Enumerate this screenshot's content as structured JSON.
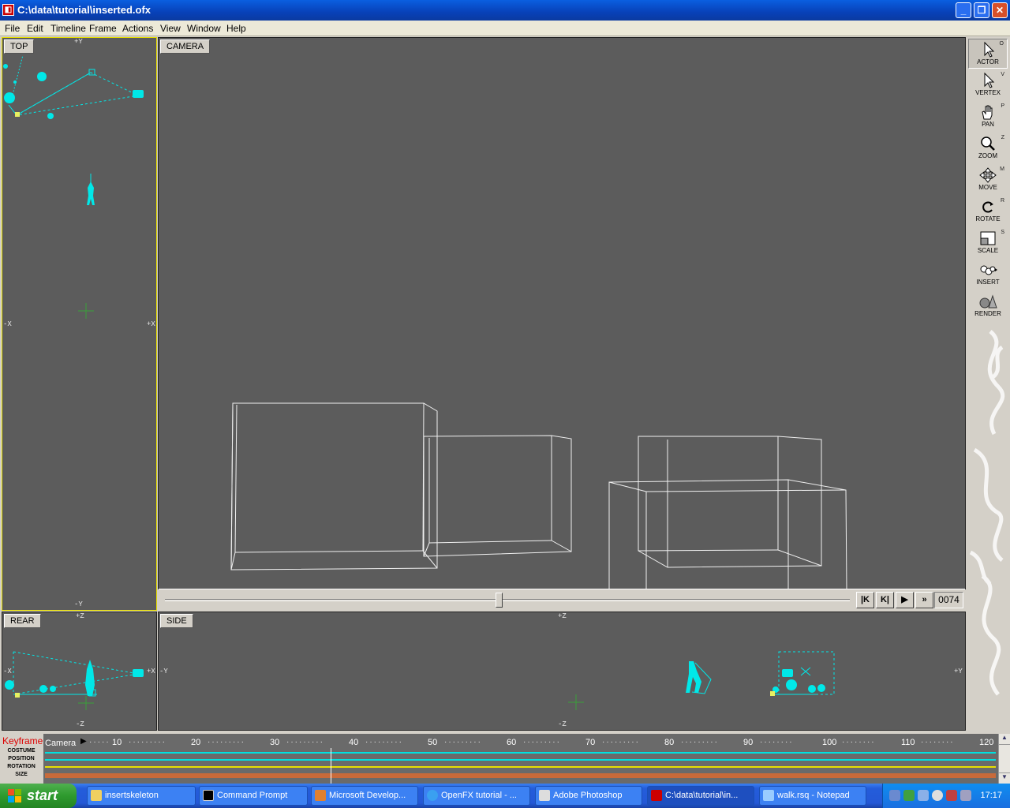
{
  "window": {
    "title": "C:\\data\\tutorial\\inserted.ofx"
  },
  "menu": [
    "File",
    "Edit",
    "Timeline",
    "Frame",
    "Actions",
    "View",
    "Window",
    "Help"
  ],
  "viewports": {
    "top": {
      "label": "TOP",
      "axes": {
        "top": "+Y",
        "bottom": "-Y",
        "left": "-X",
        "right": "+X"
      }
    },
    "camera": {
      "label": "CAMERA"
    },
    "rear": {
      "label": "REAR",
      "axes": {
        "top": "+Z",
        "bottom": "-Z",
        "left": "-X",
        "right": "+X"
      }
    },
    "side": {
      "label": "SIDE",
      "axes": {
        "top": "+Z",
        "bottom": "-Z",
        "left": "-Y",
        "right": "+Y"
      }
    }
  },
  "playback": {
    "frame": "0074",
    "slider_fraction": 0.49,
    "buttons": [
      "|K",
      "K|",
      "▶",
      "»"
    ]
  },
  "tools": [
    {
      "label": "ACTOR",
      "key": "O",
      "icon": "arrow-icon",
      "active": true
    },
    {
      "label": "VERTEX",
      "key": "V",
      "icon": "vertex-arrow-icon"
    },
    {
      "label": "PAN",
      "key": "P",
      "icon": "hand-icon"
    },
    {
      "label": "ZOOM",
      "key": "Z",
      "icon": "magnifier-icon"
    },
    {
      "label": "MOVE",
      "key": "M",
      "icon": "move-icon"
    },
    {
      "label": "ROTATE",
      "key": "R",
      "icon": "rotate-icon"
    },
    {
      "label": "SCALE",
      "key": "S",
      "icon": "scale-icon"
    },
    {
      "label": "INSERT",
      "key": "",
      "icon": "insert-icon"
    },
    {
      "label": "RENDER",
      "key": "",
      "icon": "render-icon"
    }
  ],
  "keyframer": {
    "title": "Keyframer",
    "rows": [
      "COSTUME",
      "POSITION",
      "ROTATION",
      "SIZE"
    ],
    "track": "Camera",
    "ticks": [
      "10",
      "20",
      "30",
      "40",
      "50",
      "60",
      "70",
      "80",
      "90",
      "100",
      "110",
      "120"
    ],
    "colors": {
      "costume": "#00e0e0",
      "position": "#00e0e0",
      "rotation": "#e8e000",
      "size": "#e07030"
    }
  },
  "taskbar": {
    "start": "start",
    "items": [
      {
        "label": "insertskeleton",
        "icon": "folder-icon"
      },
      {
        "label": "Command Prompt",
        "icon": "cmd-icon"
      },
      {
        "label": "Microsoft Develop...",
        "icon": "devstudio-icon"
      },
      {
        "label": "OpenFX tutorial - ...",
        "icon": "ie-icon"
      },
      {
        "label": "Adobe Photoshop",
        "icon": "photoshop-icon"
      },
      {
        "label": "C:\\data\\tutorial\\in...",
        "icon": "openfx-icon",
        "active": true
      },
      {
        "label": "walk.rsq - Notepad",
        "icon": "notepad-icon"
      }
    ],
    "clock": "17:17"
  }
}
